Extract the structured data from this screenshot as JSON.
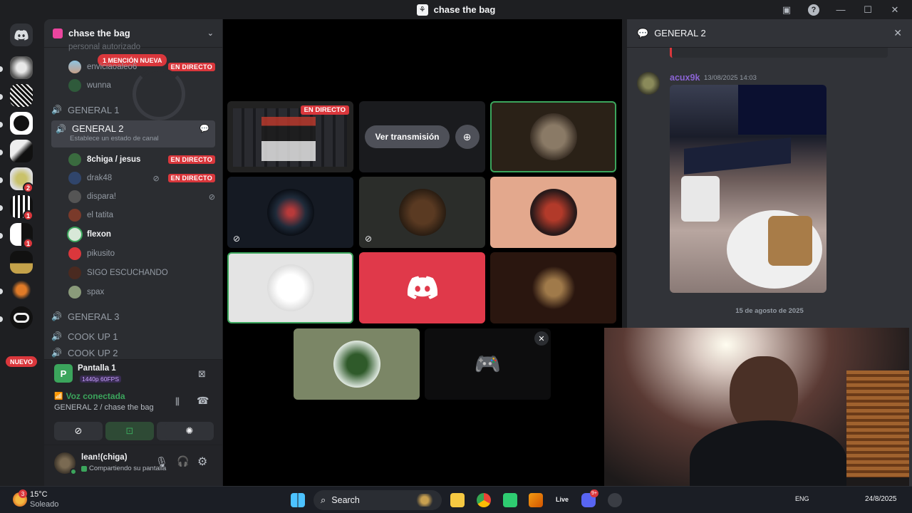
{
  "window": {
    "title": "chase the bag",
    "help": "?",
    "minimize": "—",
    "maximize": "☐",
    "close": "✕"
  },
  "rail": {
    "badges": [
      "2",
      "1",
      "1"
    ],
    "nuevo": "NUEVO"
  },
  "sidebar": {
    "guild_name": "chase the bag",
    "partial_channel": "personal autorizado",
    "mention": "1 MENCIÓN NUEVA",
    "live_label": "EN DIRECTO",
    "top_users": [
      {
        "name": "enviciaoaleo6"
      },
      {
        "name": "wunna"
      }
    ],
    "channels": {
      "general1": "GENERAL 1",
      "general2": "GENERAL 2",
      "general2_status": "Establece un estado de canal",
      "general3": "GENERAL 3",
      "cookup1": "COOK UP 1",
      "cookup2": "COOK UP 2"
    },
    "users": [
      {
        "name": "8chiga / jesus"
      },
      {
        "name": "drak48"
      },
      {
        "name": "dispara!"
      },
      {
        "name": "el tatita"
      },
      {
        "name": "flexon"
      },
      {
        "name": "pikusito"
      },
      {
        "name": "SIGO ESCUCHANDO"
      },
      {
        "name": "spax"
      }
    ],
    "stream_panel": {
      "title": "Pantalla 1",
      "quality": "1440p 60FPS"
    },
    "voice_panel": {
      "status": "Voz conectada",
      "location": "GENERAL 2 / chase the bag"
    },
    "user_panel": {
      "name": "lean!(chiga)",
      "status": "Compartiendo su pantalla"
    }
  },
  "stage": {
    "live_label": "EN DIRECTO",
    "watch_button": "Ver transmisión"
  },
  "chat": {
    "title": "GENERAL 2",
    "message": {
      "author": "acux9k",
      "timestamp": "13/08/2025 14:03"
    },
    "date_divider": "15 de agosto de 2025"
  },
  "taskbar": {
    "weather_temp": "15°C",
    "weather_desc": "Soleado",
    "weather_badge": "3",
    "search_placeholder": "Search",
    "live_app": "Live",
    "discord_badge": "9+",
    "lang": "ENG",
    "date": "24/8/2025"
  },
  "colors": {
    "accent": "#5865f2",
    "live": "#da373c",
    "speaking": "#3ba55c",
    "mention_author": "#8a63d2"
  }
}
